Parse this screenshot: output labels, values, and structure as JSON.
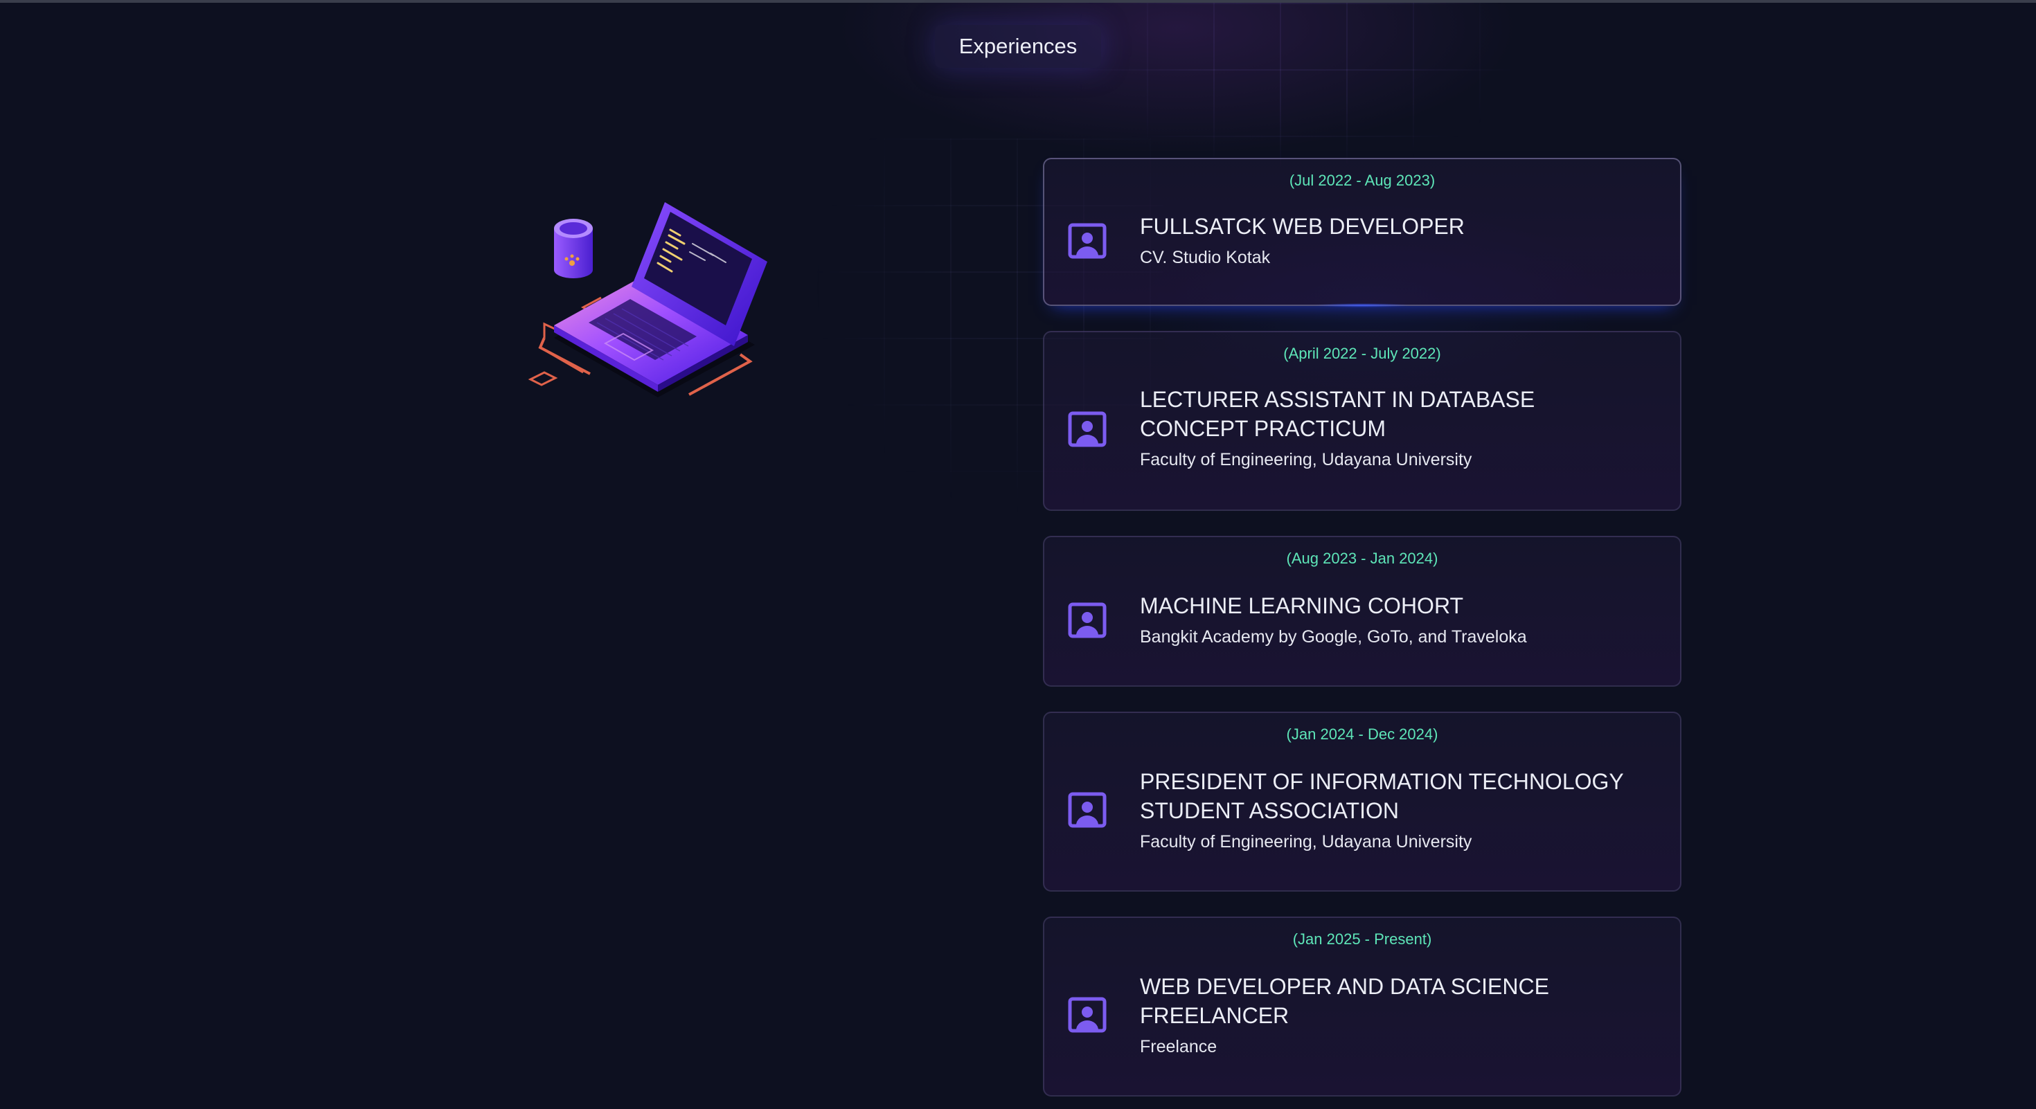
{
  "section": {
    "title": "Experiences"
  },
  "colors": {
    "background": "#0d1020",
    "accent_date": "#5ee6b8",
    "icon_purple": "#7c5cf0"
  },
  "experiences": [
    {
      "date": "(Jul 2022 - Aug 2023)",
      "role": "FULLSATCK WEB DEVELOPER",
      "company": "CV. Studio Kotak",
      "icon": "user-profile-icon"
    },
    {
      "date": "(April 2022 - July 2022)",
      "role": "LECTURER ASSISTANT IN DATABASE CONCEPT PRACTICUM",
      "company": "Faculty of Engineering, Udayana University",
      "icon": "user-profile-icon"
    },
    {
      "date": "(Aug 2023 - Jan 2024)",
      "role": "MACHINE LEARNING COHORT",
      "company": "Bangkit Academy by Google, GoTo, and Traveloka",
      "icon": "user-profile-icon"
    },
    {
      "date": "(Jan 2024 - Dec 2024)",
      "role": "PRESIDENT OF INFORMATION TECHNOLOGY STUDENT ASSOCIATION",
      "company": "Faculty of Engineering, Udayana University",
      "icon": "user-profile-icon"
    },
    {
      "date": "(Jan 2025 - Present)",
      "role": "WEB DEVELOPER AND DATA SCIENCE FREELANCER",
      "company": "Freelance",
      "icon": "user-profile-icon"
    }
  ]
}
